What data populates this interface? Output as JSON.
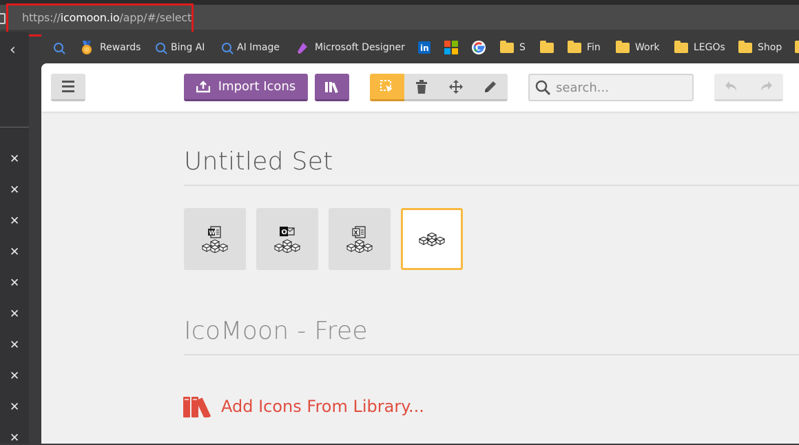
{
  "browser": {
    "url_scheme": "https://",
    "url_host": "icomoon.io",
    "url_path": "/app/#/select"
  },
  "bookmarks": [
    {
      "label": "",
      "icon": "search-icon"
    },
    {
      "label": "Rewards",
      "icon": "rewards-medal-icon"
    },
    {
      "label": "Bing AI",
      "icon": "search-icon"
    },
    {
      "label": "AI Image",
      "icon": "search-icon"
    },
    {
      "label": "Microsoft Designer",
      "icon": "designer-icon"
    },
    {
      "label": "",
      "icon": "linkedin-icon"
    },
    {
      "label": "",
      "icon": "microsoft-icon"
    },
    {
      "label": "",
      "icon": "google-icon"
    },
    {
      "label": "S",
      "icon": "folder-icon"
    },
    {
      "label": "",
      "icon": "folder-icon"
    },
    {
      "label": "Fin",
      "icon": "folder-icon"
    },
    {
      "label": "Work",
      "icon": "folder-icon"
    },
    {
      "label": "LEGOs",
      "icon": "folder-icon"
    },
    {
      "label": "Shop",
      "icon": "folder-icon"
    }
  ],
  "toolbar": {
    "import_label": "Import Icons",
    "search_placeholder": "search..."
  },
  "sets": [
    {
      "title": "Untitled Set"
    },
    {
      "title": "IcoMoon - Free"
    }
  ],
  "glyphs": [
    {
      "badge": "W",
      "selected": false
    },
    {
      "badge": "O",
      "selected": false
    },
    {
      "badge": "X",
      "selected": false
    },
    {
      "badge": "",
      "selected": true
    }
  ],
  "library": {
    "add_label": "Add Icons From Library..."
  },
  "colors": {
    "accent_purple": "#8b5a9e",
    "selection_orange": "#f9b940",
    "library_red": "#e04d3f",
    "highlight_red": "#e11b1b"
  }
}
